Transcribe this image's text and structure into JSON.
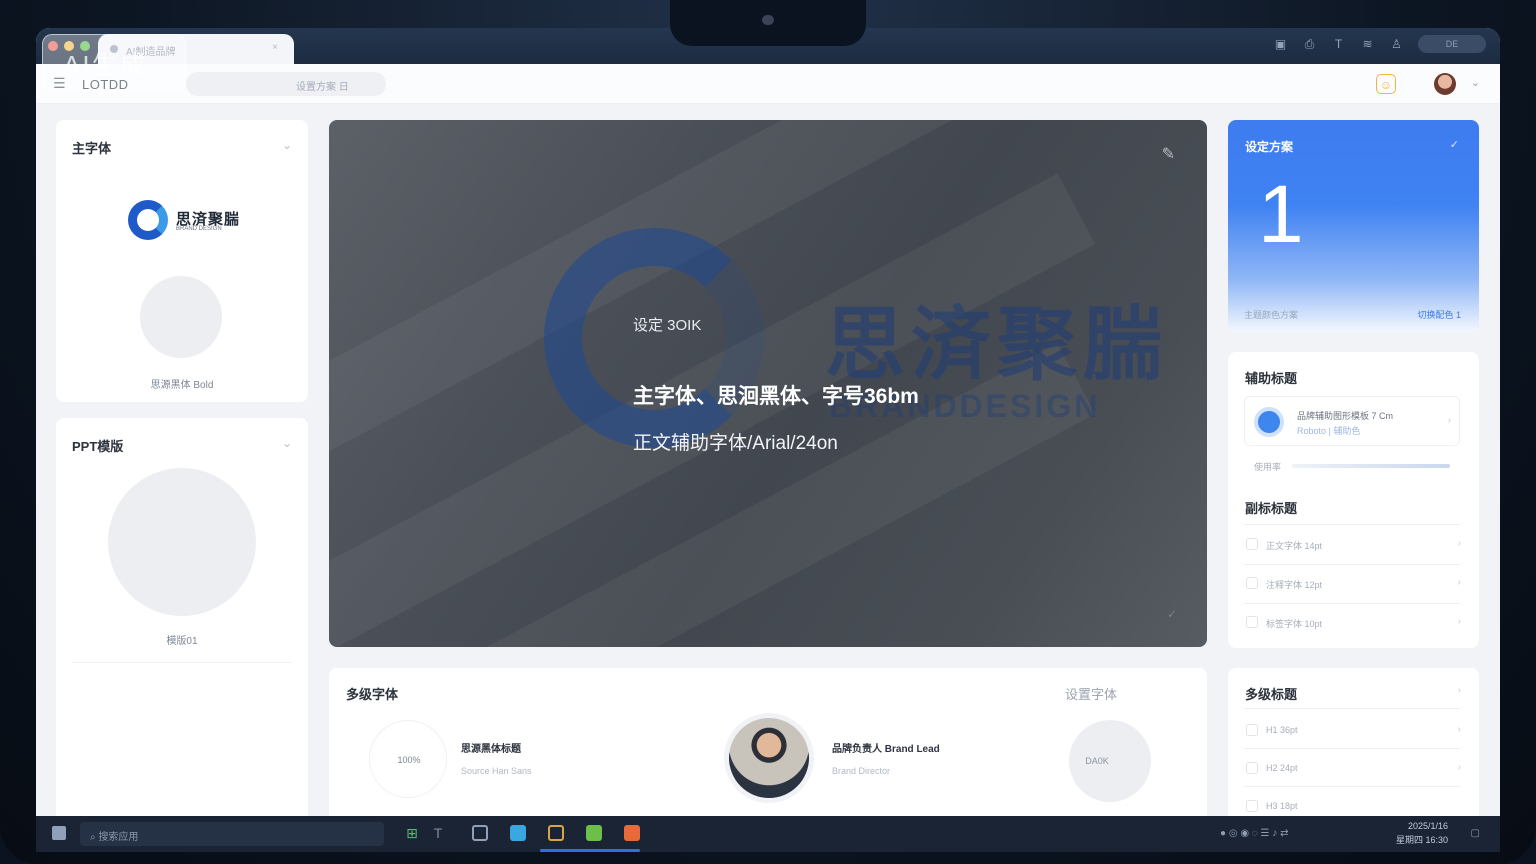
{
  "browser": {
    "tab_title": "AI制造品牌",
    "tab_close": "×",
    "pill_label": "DE",
    "watermark": "AI生成"
  },
  "header": {
    "brand": "LOTDD",
    "address_text": "设置方案 日",
    "menu_glyph": "☰",
    "chevron": "⌄"
  },
  "left": {
    "font_card": {
      "title": "主字体",
      "logo_name": "思済聚腨",
      "logo_sub": "BRAND DESIGN",
      "caption": "思源黑体 Bold"
    },
    "template_card": {
      "title": "PPT模版",
      "caption": "模版01"
    }
  },
  "hero": {
    "watermark_logo": "思済聚腨",
    "watermark_sub": "BRANDDESIGN",
    "small_label": "设定 3OIK",
    "headline": "主字体、思洄黑体、字号36bm",
    "body": "正文辅助字体/Arial/24on",
    "edit_glyph": "✎",
    "check_glyph": "✓"
  },
  "right": {
    "plan_card": {
      "title": "设定方案",
      "number": "1",
      "footer_left": "主题颜色方案",
      "footer_right": "切换配色 1",
      "check_glyph": "✓"
    },
    "aux_card": {
      "title": "辅助标题",
      "item_text": "品牌辅助图形模板 7 Cm",
      "item_sub": "Roboto | 辅助色",
      "progress_label": "使用率",
      "section_title": "副标标题",
      "rows": [
        "正文字体 14pt",
        "注释字体 12pt",
        "标签字体 10pt"
      ]
    },
    "multi_card": {
      "title": "多级标题",
      "rows": [
        "H1 36pt",
        "H2 24pt",
        "H3 18pt"
      ]
    }
  },
  "bottom": {
    "title": "多级字体",
    "right_label": "设置字体",
    "left_badge": "100%",
    "left_name": "思源黑体标题",
    "left_sub": "Source Han Sans",
    "mid_name": "品牌负责人 Brand Lead",
    "mid_sub": "Brand Director",
    "right_badge": "DA0K"
  },
  "taskbar": {
    "search_placeholder": "搜索应用",
    "clock_time": "2025/1/16",
    "clock_sub": "星期四 16:30"
  },
  "colors": {
    "accent": "#3e7cf0",
    "logo_blue": "#1e5ac8",
    "traffic_red": "#ec6a5e",
    "traffic_yellow": "#f4bf4f",
    "traffic_green": "#61c554"
  },
  "icons": {
    "chrome": [
      "screenshot-icon",
      "print-icon",
      "text-icon",
      "layers-icon",
      "user-icon"
    ],
    "taskbar_apps": [
      "grid-app-icon",
      "text-app-icon",
      "monitor-app-icon",
      "browser-app-icon",
      "calendar-app-icon",
      "notes-app-icon",
      "slides-app-icon"
    ]
  }
}
